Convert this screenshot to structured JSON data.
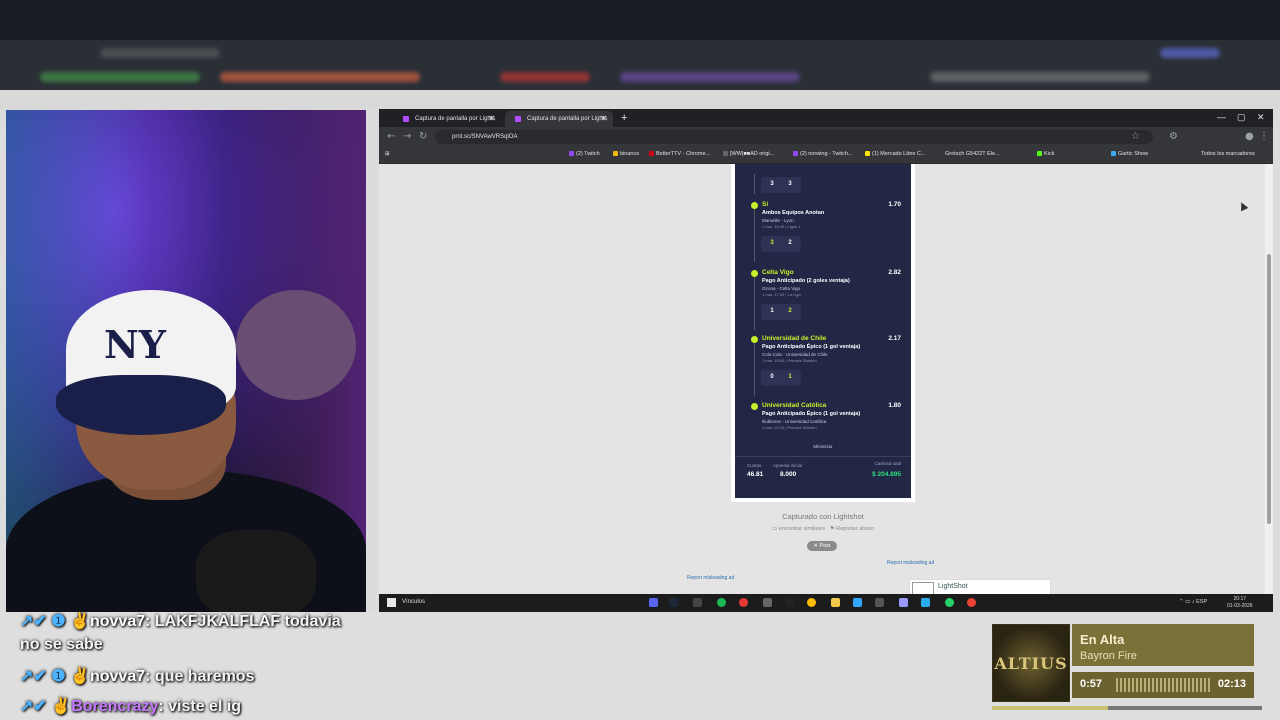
{
  "browser": {
    "tabs": [
      {
        "label": "Captura de pantalla por Lights",
        "active": false
      },
      {
        "label": "Captura de pantalla por Lights",
        "active": true
      }
    ],
    "url": "prnt.sc/SNVAwVRSqlOA",
    "bookmarks": [
      "(2) Twitch",
      "binance",
      "BetterTTV - Chrome...",
      "[WW]■■AD origi...",
      "(2) norwing - Twitch...",
      "(1) Mercado Libre C...",
      "Gretsch G5422T Ele...",
      "Kick",
      "Gartic Show"
    ],
    "all_bookmarks": "Todos los marcadores"
  },
  "bet_slip": {
    "top_score": [
      "3",
      "3"
    ],
    "selections": [
      {
        "pick": "Sí",
        "odd": "1.70",
        "market": "Ambos Equipos Anotan",
        "match": "Marseille - Lyon",
        "date": "1 mar, 16:45 | Ligue 1",
        "score": [
          "3",
          "2"
        ]
      },
      {
        "pick": "Celta Vigo",
        "odd": "2.82",
        "market": "Pago Anticipado (2 goles ventaja)",
        "match": "Girona - Celta Vigo",
        "date": "1 mar, 17:00 | La Liga",
        "score": [
          "1",
          "2"
        ]
      },
      {
        "pick": "Universidad de Chile",
        "odd": "2.17",
        "market": "Pago Anticipado Épico (1 gol ventaja)",
        "match": "Colo-Colo - Universidad de Chile",
        "date": "1 mar, 18:00 | Primera División",
        "score": [
          "0",
          "1"
        ]
      },
      {
        "pick": "Universidad Católica",
        "odd": "1.80",
        "market": "Pago Anticipado Épico (1 gol ventaja)",
        "match": "Ñublense - Universidad Católica",
        "date": "1 mar, 20:30 | Primera División",
        "score": null
      }
    ],
    "minimize_label": "Minimizar",
    "totals": {
      "cuotas_label": "Cuotas",
      "cuotas_value": "46.81",
      "apuesta_label": "Apuesta inicial",
      "apuesta_value": "8.000",
      "cashout_label": "Cashout total",
      "cashout_value": "$ 204.895"
    }
  },
  "page": {
    "captured_by": "Capturado con Lightshot",
    "find_similar": "encontrar similares",
    "report_abuse": "Reportar abuso",
    "post_button": "✕ Post",
    "report_ad_left": "Report misleading ad",
    "report_ad_right": "Report misleading ad",
    "lightshot_brand": "LightShot"
  },
  "taskbar": {
    "vinculos": "Vínculos",
    "lang": "ESP",
    "time": "20:17",
    "date": "01-03-2026"
  },
  "chat": [
    {
      "user": "novva7",
      "message": "LAKFJKALFLAF todavia"
    },
    {
      "user": "",
      "message": "no se sabe"
    },
    {
      "user": "novva7",
      "message": "que haremos"
    },
    {
      "user": "Borencrazy",
      "message": "viste el ig"
    }
  ],
  "music": {
    "album_text": "ALTIUS",
    "track": "En Alta",
    "artist": "Bayron Fire",
    "current": "0:57",
    "total": "02:13",
    "progress": 0.43
  },
  "colors": {
    "accent": "#c8f02a",
    "cashout": "#2ee07a",
    "slip_bg": "#232746"
  }
}
